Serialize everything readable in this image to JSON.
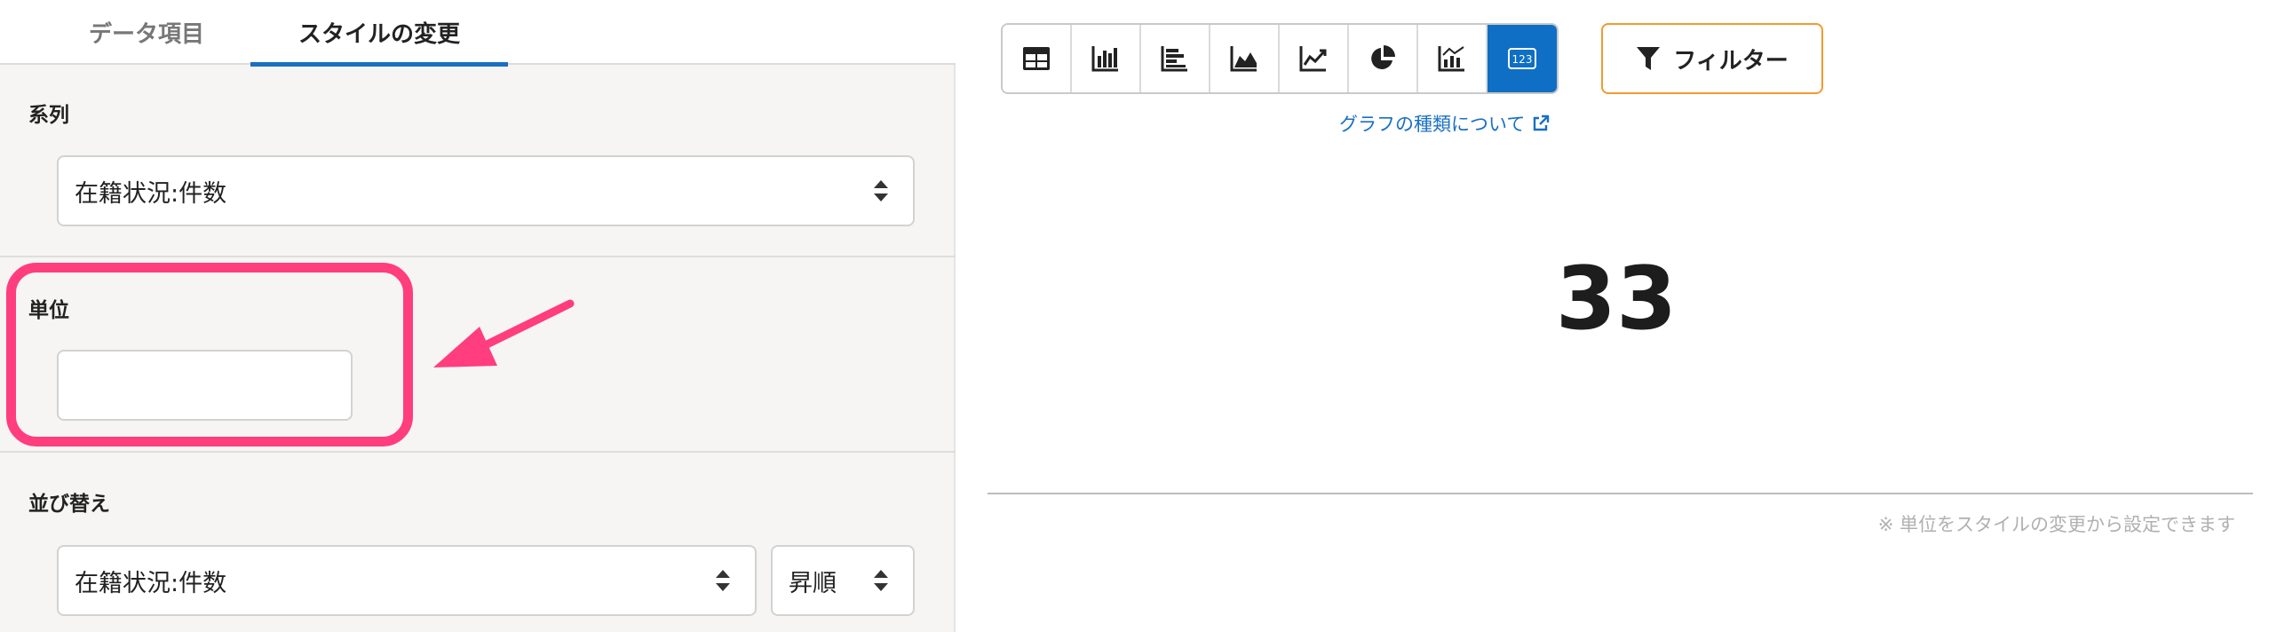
{
  "tabs": [
    {
      "label": "データ項目",
      "active": false
    },
    {
      "label": "スタイルの変更",
      "active": true
    }
  ],
  "series": {
    "label": "系列",
    "selected": "在籍状況:件数"
  },
  "unit": {
    "label": "単位",
    "value": ""
  },
  "sort": {
    "label": "並び替え",
    "field_selected": "在籍状況:件数",
    "order_selected": "昇順"
  },
  "annotation": {
    "highlight_color": "#ff3d7f"
  },
  "chart_toolbar": {
    "buttons": [
      {
        "icon": "table-icon",
        "active": false
      },
      {
        "icon": "bar-chart-icon",
        "active": false
      },
      {
        "icon": "horizontal-bar-chart-icon",
        "active": false
      },
      {
        "icon": "area-chart-icon",
        "active": false
      },
      {
        "icon": "line-chart-icon",
        "active": false
      },
      {
        "icon": "pie-chart-icon",
        "active": false
      },
      {
        "icon": "combo-chart-icon",
        "active": false
      },
      {
        "icon": "number-icon",
        "active": true,
        "label": "123"
      }
    ],
    "active_color": "#0f6fc5"
  },
  "filter": {
    "label": "フィルター",
    "icon": "filter-icon",
    "border_color": "#f39a2e"
  },
  "chart_link": {
    "label": "グラフの種類について",
    "icon": "external-link-icon",
    "color": "#1a6fc2"
  },
  "result": {
    "value": "33"
  },
  "note": "※ 単位をスタイルの変更から設定できます"
}
